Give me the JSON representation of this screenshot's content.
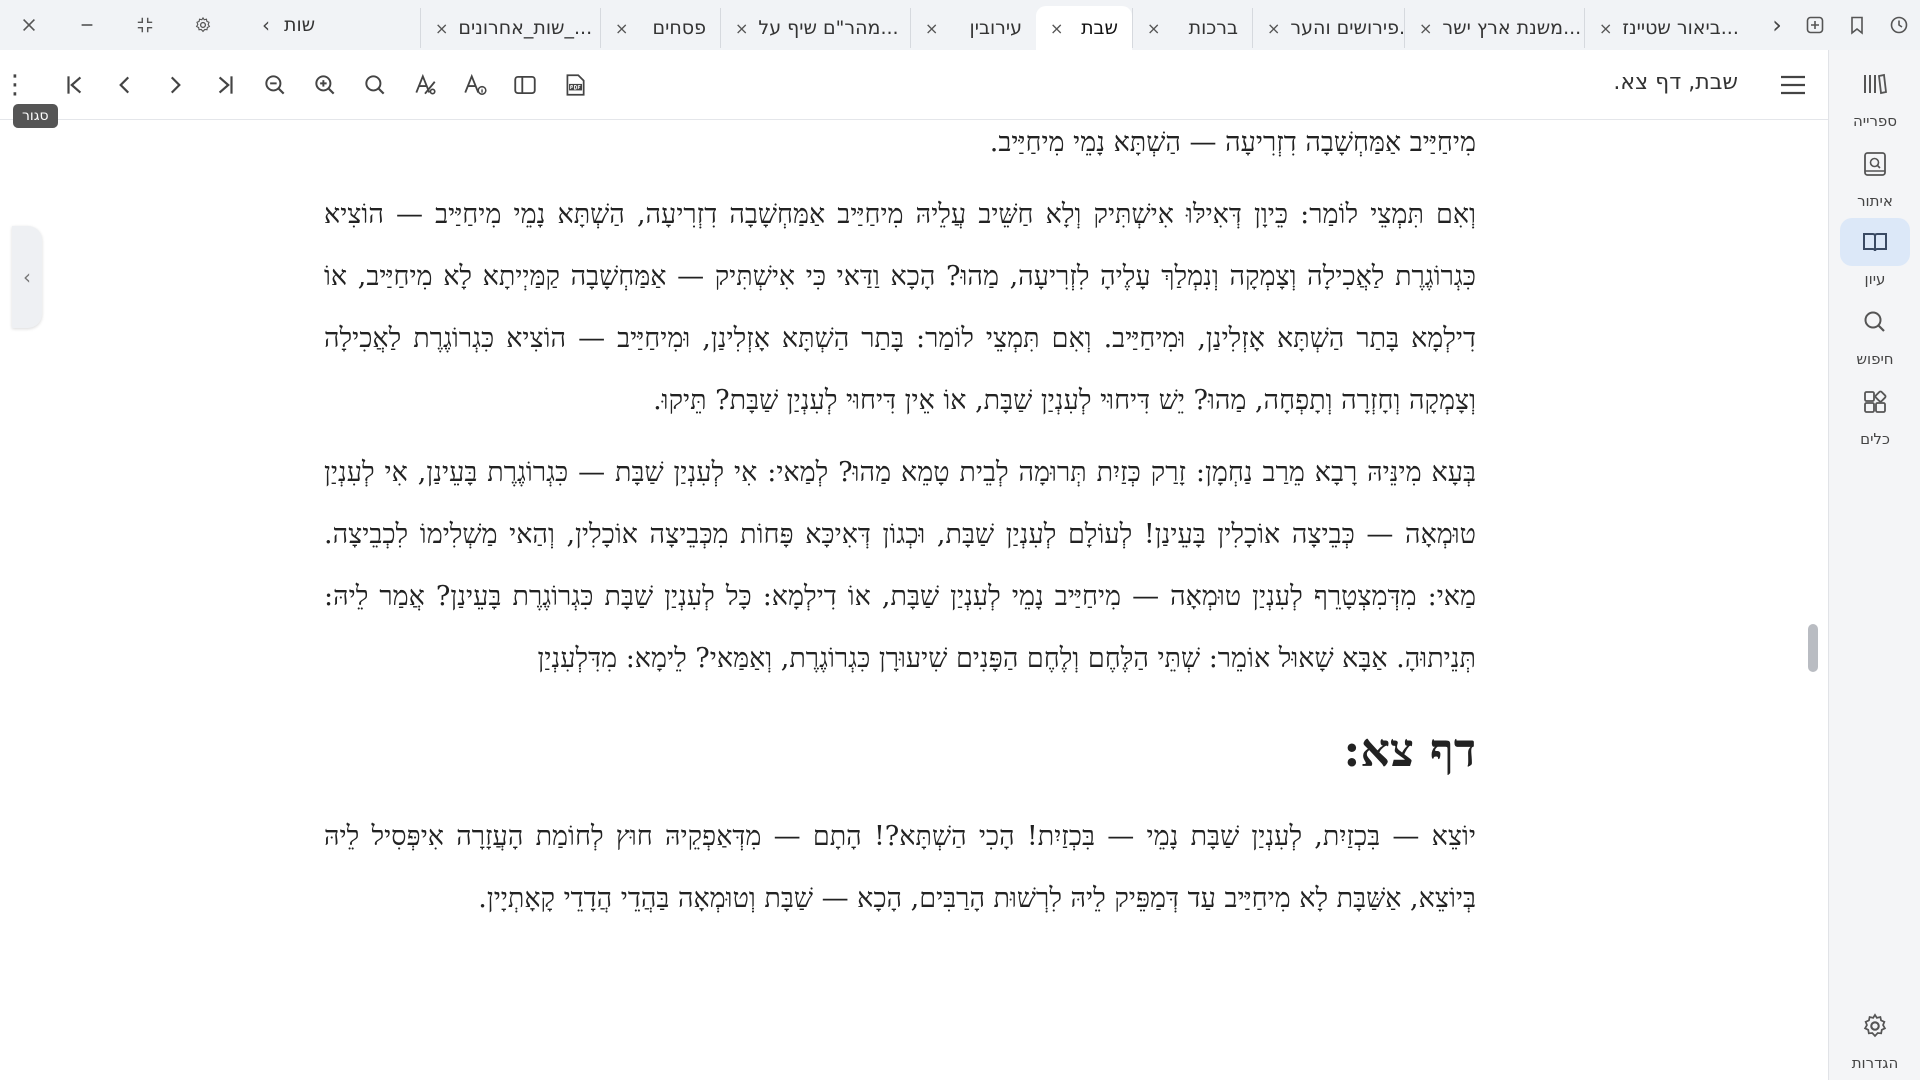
{
  "tabs": [
    {
      "label": "ביאור שטיינז...",
      "active": false
    },
    {
      "label": "משנת ארץ ישר...",
      "active": false
    },
    {
      "label": "פירושים והער...",
      "active": false
    },
    {
      "label": "ברכות",
      "active": false
    },
    {
      "label": "שבת",
      "active": true
    },
    {
      "label": "עירובין",
      "active": false
    },
    {
      "label": "מהר\"ם שיף על...",
      "active": false
    },
    {
      "label": "פסחים",
      "active": false
    },
    {
      "label": "שות_אחרונים_...",
      "active": false
    }
  ],
  "tab_partial": "שות",
  "tab_close_glyph": "×",
  "toolbar": {
    "doc_title": "שבת, דף צא.",
    "tooltip": "סגור"
  },
  "sidebar": {
    "library_label": "ספרייה",
    "locate_label": "איתור",
    "view_label": "עיון",
    "search_label": "חיפוש",
    "tools_label": "כלים",
    "settings_label": "הגדרות"
  },
  "content": {
    "para_0": "מִיחַיַּיב אַמַּחְשָׁבָה דִזְרִיעָה — הַשְׁתָּא נָמֵי מִיחַיַּיב.",
    "para_1": "וְאִם תִּמְצֵי לוֹמַר: כֵּיוָן דְּאִילּוּ אִישְׁתִּיק וְלָא חַשֵּׁיב עֲלֵיהּ מִיחַיַּיב אַמַּחְשָׁבָה דִזְרִיעָה, הַשְׁתָּא נָמֵי מִיחַיַּיב — הוֹצִיא כִּגְרוֹגֶרֶת לַאֲכִילָה וְצָמְקָה וְנִמְלַךְ עָלֶיהָ לִזְרִיעָה, מַהוּ? הָכָא וַדַּאי כִּי אִישְׁתִּיק — אַמַּחְשָׁבָה קַמַּיְיתָא לָא מִיחַיַּיב, אוֹ דִילְמָא בָּתַר הַשְׁתָּא אָזְלִינַן, וּמִיחַיַּיב. וְאִם תִּמְצֵי לוֹמַר: בָּתַר הַשְׁתָּא אָזְלִינַן, וּמִיחַיַּיב — הוֹצִיא כִּגְרוֹגֶרֶת לַאֲכִילָה וְצָמְקָה וְחָזְרָה וְתָפְחָה, מַהוּ? יֵשׁ דִּיחוּי לְעִנְיַן שַׁבָּת, אוֹ אֵין דִּיחוּי לְעִנְיַן שַׁבָּת? תֵּיקוּ.",
    "para_2": "בְּעָא מִינֵּיהּ רָבָא מֵרַב נַחְמָן: זָרַק כְּזַיִת תְּרוּמָה לְבֵית טָמֵא מַהוּ? לְמַאי: אִי לְעִנְיַן שַׁבָּת — כִּגְרוֹגֶרֶת בָּעֵינַן, אִי לְעִנְיַן טוּמְאָה — כְּבֵיצָה אוֹכָלִין בָּעֵינַן! לְעוֹלָם לְעִנְיַן שַׁבָּת, וּכְגוֹן דְּאִיכָּא פָּחוֹת מִכְּבֵיצָה אוֹכָלִין, וְהַאי מַשְׁלִימוֹ לִכְבֵיצָה. מַאי: מִדְּמִצְטָרֵף לְעִנְיַן טוּמְאָה — מִיחַיַּיב נָמֵי לְעִנְיַן שַׁבָּת, אוֹ דִילְמָא: כָּל לְעִנְיַן שַׁבָּת כִּגְרוֹגֶרֶת בָּעֵינַן? אֲמַר לֵיהּ: תְּנֵיתוּהָ. אַבָּא שָׁאוּל אוֹמֵר: שְׁתֵּי הַלֶּחֶם וְלֶחֶם הַפָּנִים שִׁיעוּרָן כִּגְרוֹגֶרֶת, וְאַמַּאי? לֵימָא: מִדִּלְעִנְיַן",
    "heading": "דף צא:",
    "para_3": "יוֹצֵא — בִּכְזַיִת, לְעִנְיַן שַׁבָּת נָמֵי — בִּכְזַיִת! הָכִי הַשְׁתָּא?! הָתָם — מִדְּאַפְקֵיהּ חוּץ לְחוֹמַת הָעֲזָרָה אִיפְּסִיל לֵיהּ בְּיוֹצֵא, אַשַּׁבָּת לָא מִיחַיַּיב עַד דְּמַפֵּיק לֵיהּ לִרְשׁוּת הָרַבִּים, הָכָא — שַׁבָּת וְטוּמְאָה בַּהֲדֵי הֲדָדֵי קָאָתְיָין."
  }
}
